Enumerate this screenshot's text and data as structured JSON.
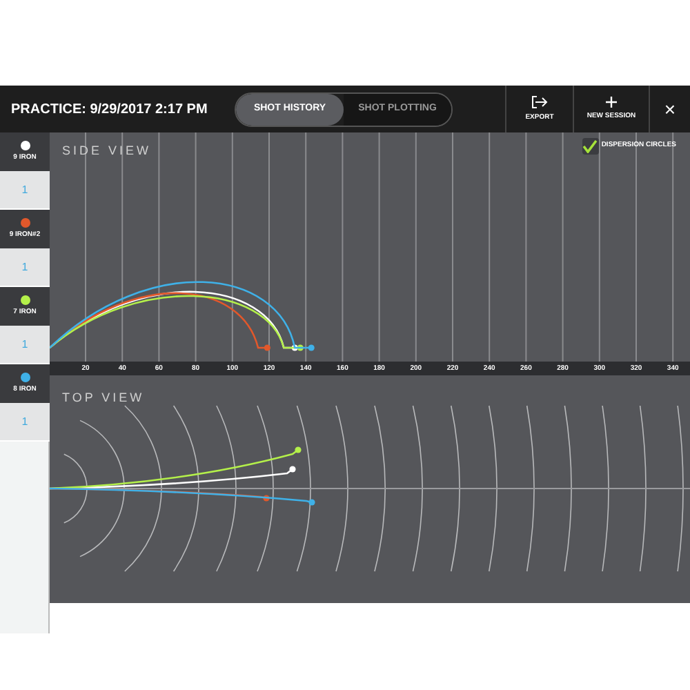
{
  "header": {
    "title": "PRACTICE: 9/29/2017 2:17 PM",
    "tabs": [
      {
        "label": "SHOT HISTORY",
        "selected": true
      },
      {
        "label": "SHOT PLOTTING",
        "selected": false
      }
    ],
    "actions": [
      {
        "kind": "export",
        "label": "EXPORT"
      },
      {
        "kind": "new",
        "label": "NEW SESSION"
      },
      {
        "kind": "close",
        "label": "×"
      }
    ]
  },
  "clubs": [
    {
      "name": "9 IRON",
      "color": "#ffffff",
      "count": "1"
    },
    {
      "name": "9 IRON#2",
      "color": "#e2582b",
      "count": "1"
    },
    {
      "name": "7 IRON",
      "color": "#b4f04a",
      "count": "1"
    },
    {
      "name": "8 IRON",
      "color": "#3fb1e8",
      "count": "1"
    }
  ],
  "side_view": {
    "title": "SIDE VIEW",
    "dispersion_circles": {
      "label": "DISPERSION CIRCLES",
      "checked": true
    },
    "x_labels": [
      "20",
      "40",
      "60",
      "80",
      "100",
      "120",
      "140",
      "160",
      "180",
      "200",
      "220",
      "240",
      "260",
      "280",
      "300",
      "320",
      "340"
    ]
  },
  "top_view": {
    "title": "TOP VIEW"
  }
}
